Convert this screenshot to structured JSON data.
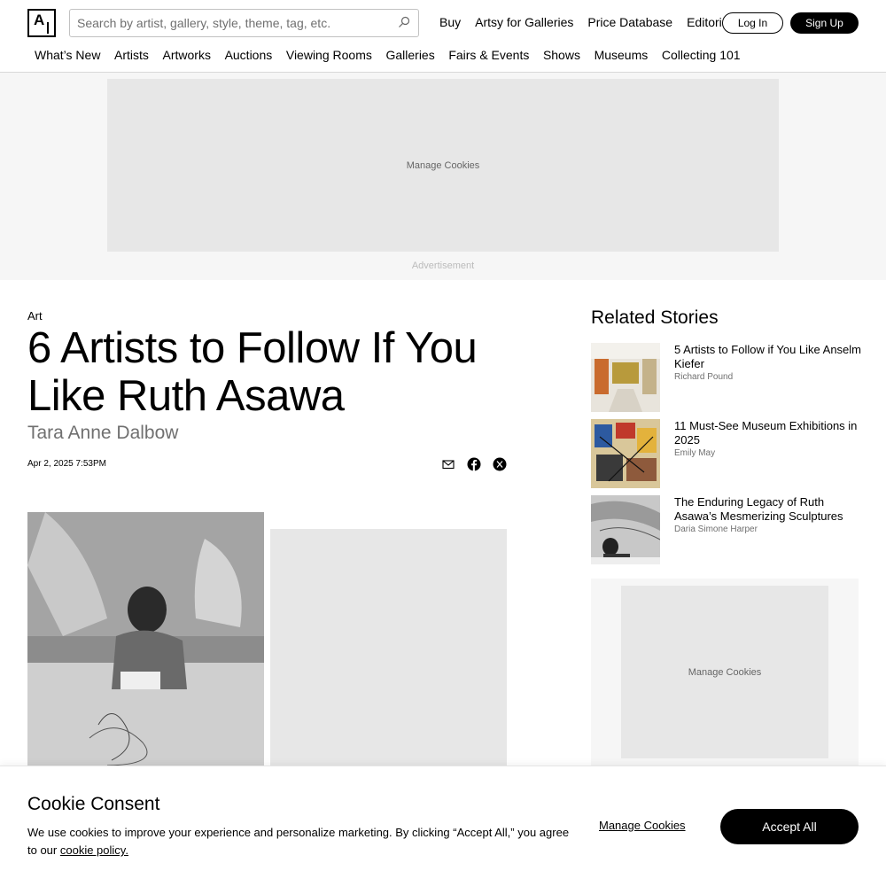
{
  "header": {
    "logo_text": "A",
    "search_placeholder": "Search by artist, gallery, style, theme, tag, etc.",
    "top_links": [
      "Buy",
      "Artsy for Galleries",
      "Price Database",
      "Editorial"
    ],
    "login_label": "Log In",
    "signup_label": "Sign Up",
    "nav": [
      "What’s New",
      "Artists",
      "Artworks",
      "Auctions",
      "Viewing Rooms",
      "Galleries",
      "Fairs & Events",
      "Shows",
      "Museums",
      "Collecting 101"
    ]
  },
  "ad_top": {
    "placeholder": "Manage Cookies",
    "label": "Advertisement"
  },
  "article": {
    "vertical": "Art",
    "headline": "6 Artists to Follow If You Like Ruth Asawa",
    "author": "Tara Anne Dalbow",
    "date": "Apr 2, 2025 7:53PM",
    "share_icons": [
      "mail-icon",
      "facebook-icon",
      "x-icon"
    ]
  },
  "related": {
    "title": "Related Stories",
    "stories": [
      {
        "title": "5 Artists to Follow if You Like Anselm Kiefer",
        "author": "Richard Pound"
      },
      {
        "title": "11 Must-See Museum Exhibitions in 2025",
        "author": "Emily May"
      },
      {
        "title": "The Enduring Legacy of Ruth Asawa’s Mesmerizing Sculptures",
        "author": "Daria Simone Harper"
      }
    ]
  },
  "ad_side": {
    "placeholder": "Manage Cookies"
  },
  "cookie": {
    "title": "Cookie Consent",
    "body": "We use cookies to improve your experience and personalize marketing. By clicking “Accept All,” you agree to our ",
    "policy_link": "cookie policy.",
    "manage_label": "Manage Cookies",
    "accept_label": "Accept All"
  }
}
